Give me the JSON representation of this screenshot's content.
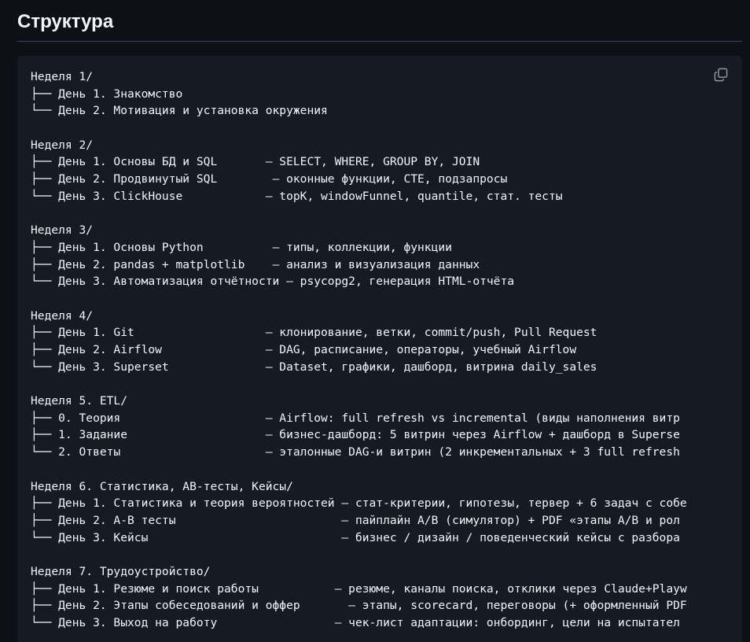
{
  "heading": "Структура",
  "copy_icon": "copy-icon",
  "code_lines": [
    "Неделя 1/",
    "├── День 1. Знакомство",
    "└── День 2. Мотивация и установка окружения",
    "",
    "Неделя 2/",
    "├── День 1. Основы БД и SQL       — SELECT, WHERE, GROUP BY, JOIN",
    "├── День 2. Продвинутый SQL        — оконные функции, CTE, подзапросы",
    "└── День 3. ClickHouse            — topK, windowFunnel, quantile, стат. тесты",
    "",
    "Неделя 3/",
    "├── День 1. Основы Python          — типы, коллекции, функции",
    "├── День 2. pandas + matplotlib    — анализ и визуализация данных",
    "└── День 3. Автоматизация отчётности — psycopg2, генерация HTML-отчёта",
    "",
    "Неделя 4/",
    "├── День 1. Git                   — клонирование, ветки, commit/push, Pull Request",
    "├── День 2. Airflow               — DAG, расписание, операторы, учебный Airflow",
    "└── День 3. Superset              — Dataset, графики, дашборд, витрина daily_sales",
    "",
    "Неделя 5. ETL/",
    "├── 0. Теория                     — Airflow: full refresh vs incremental (виды наполнения витр",
    "├── 1. Задание                    — бизнес-дашборд: 5 витрин через Airflow + дашборд в Superse",
    "└── 2. Ответы                     — эталонные DAG-и витрин (2 инкрементальных + 3 full refresh",
    "",
    "Неделя 6. Статистика, AB-тесты, Кейсы/",
    "├── День 1. Статистика и теория вероятностей — стат-критерии, гипотезы, тервер + 6 задач с собе",
    "├── День 2. A-B тесты                        — пайплайн A/B (симулятор) + PDF «этапы A/B и рол",
    "└── День 3. Кейсы                            — бизнес / дизайн / поведенческий кейсы с разбора",
    "",
    "Неделя 7. Трудоустройство/",
    "├── День 1. Резюме и поиск работы           — резюме, каналы поиска, отклики через Claude+Playw",
    "├── День 2. Этапы собеседований и оффер       — этапы, scorecard, переговоры (+ оформленный PDF",
    "└── День 3. Выход на работу                 — чек-лист адаптации: онбординг, цели на испытател"
  ]
}
